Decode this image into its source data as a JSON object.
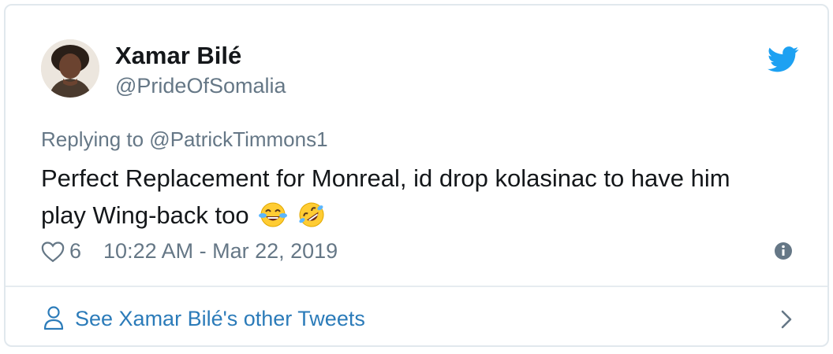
{
  "tweet": {
    "author_name": "Xamar Bilé",
    "author_handle": "@PrideOfSomalia",
    "replying_to": "Replying to @PatrickTimmons1",
    "text_line1": "Perfect Replacement for Monreal, id drop kolasinac to have him",
    "text_line2": "play Wing-back too",
    "emojis": [
      "face-with-tears-of-joy",
      "rolling-on-the-floor-laughing"
    ],
    "like_count": "6",
    "timestamp": "10:22 AM - Mar 22, 2019"
  },
  "footer": {
    "label": "See Xamar Bilé's other Tweets"
  },
  "colors": {
    "text": "#14171a",
    "secondary": "#657786",
    "link": "#2b7bb9",
    "twitter_blue": "#1da1f2",
    "border": "#e1e8ed"
  },
  "icons": {
    "brand": "twitter-bird-icon",
    "like": "heart-icon",
    "info": "info-icon",
    "profile": "person-icon",
    "navigate": "chevron-right-icon"
  }
}
